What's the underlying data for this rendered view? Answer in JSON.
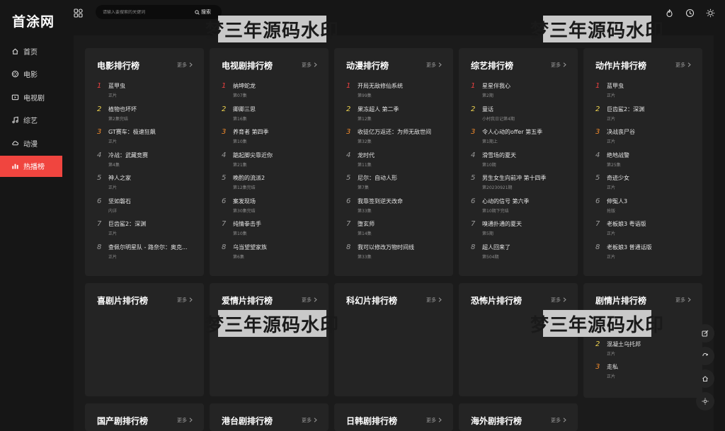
{
  "logo": "首涂网",
  "nav": [
    {
      "label": "首页",
      "icon": "home-icon"
    },
    {
      "label": "电影",
      "icon": "film-reel-icon"
    },
    {
      "label": "电视剧",
      "icon": "tv-icon"
    },
    {
      "label": "综艺",
      "icon": "music-note-icon"
    },
    {
      "label": "动漫",
      "icon": "cloud-icon"
    },
    {
      "label": "热播榜",
      "icon": "chart-icon",
      "active": true
    }
  ],
  "search": {
    "placeholder": "请输入要搜索的关键词",
    "button": "搜索"
  },
  "more_label": "更多",
  "watermark": "梦三年源码水印",
  "boards": [
    {
      "title": "电影排行榜",
      "items": [
        {
          "name": "蓝甲虫",
          "sub": "正片"
        },
        {
          "name": "植物也坏坏",
          "sub": "第2集完结"
        },
        {
          "name": "GT赛车：极速狂飙",
          "sub": "正片"
        },
        {
          "name": "冷战：武藏竞赛",
          "sub": "第4集"
        },
        {
          "name": "神人之家",
          "sub": "正片"
        },
        {
          "name": "坚如磐石",
          "sub": "内详"
        },
        {
          "name": "巨齿鲨2：深渊",
          "sub": "正片"
        },
        {
          "name": "查佩尔明星队 - 路奈尔：奥克...",
          "sub": "正片"
        }
      ]
    },
    {
      "title": "电视剧排行榜",
      "items": [
        {
          "name": "纳坤蛇龙",
          "sub": "第07集"
        },
        {
          "name": "卿卿三思",
          "sub": "第16集"
        },
        {
          "name": "养育者 第四季",
          "sub": "第10集"
        },
        {
          "name": "踮起脚尖靠近你",
          "sub": "第21集"
        },
        {
          "name": "晚酌的流派2",
          "sub": "第12集完结"
        },
        {
          "name": "案发现场",
          "sub": "第30集完结"
        },
        {
          "name": "纯情拳击手",
          "sub": "第10集"
        },
        {
          "name": "乌当望望家族",
          "sub": "第6集"
        }
      ]
    },
    {
      "title": "动漫排行榜",
      "items": [
        {
          "name": "开局无敌修仙系统",
          "sub": "第99集"
        },
        {
          "name": "果冻超人 第二季",
          "sub": "第12集"
        },
        {
          "name": "收徒亿万返还：为师无敌世间",
          "sub": "第32集"
        },
        {
          "name": "龙时代",
          "sub": "第11集"
        },
        {
          "name": "尼尔：自动人形",
          "sub": "第7集"
        },
        {
          "name": "我靠签到逆天改命",
          "sub": "第33集"
        },
        {
          "name": "堕玄师",
          "sub": "第14集"
        },
        {
          "name": "我可以修改万物时间线",
          "sub": "第33集"
        }
      ]
    },
    {
      "title": "综艺排行榜",
      "items": [
        {
          "name": "星星伴我心",
          "sub": "第2期"
        },
        {
          "name": "童话",
          "sub": "小村我日记第4期"
        },
        {
          "name": "令人心动的offer 第五季",
          "sub": "第1期上"
        },
        {
          "name": "滑雪场的夏天",
          "sub": "第10期"
        },
        {
          "name": "男生女生向前冲 第十四季",
          "sub": "第20230921期"
        },
        {
          "name": "心动的信号 第六季",
          "sub": "第10期下完结"
        },
        {
          "name": "嗅通扑通的夏天",
          "sub": "第5期"
        },
        {
          "name": "超人回来了",
          "sub": "第504期"
        }
      ]
    },
    {
      "title": "动作片排行榜",
      "items": [
        {
          "name": "蓝甲虫",
          "sub": "正片"
        },
        {
          "name": "巨齿鲨2：深渊",
          "sub": "正片"
        },
        {
          "name": "决战丧尸谷",
          "sub": "正片"
        },
        {
          "name": "绝地战警",
          "sub": "第25集"
        },
        {
          "name": "奇迹少女",
          "sub": "正片"
        },
        {
          "name": "伸冤人3",
          "sub": "抢版"
        },
        {
          "name": "老板娘3 粤语版",
          "sub": "正片"
        },
        {
          "name": "老板娘3 普通话版",
          "sub": "正片"
        }
      ]
    },
    {
      "title": "喜剧片排行榜",
      "items": []
    },
    {
      "title": "爱情片排行榜",
      "items": []
    },
    {
      "title": "科幻片排行榜",
      "items": []
    },
    {
      "title": "恐怖片排行榜",
      "items": []
    },
    {
      "title": "剧情片排行榜",
      "items": [
        {
          "name": "蓝甲虫",
          "sub": ""
        },
        {
          "name": "混凝土乌托邦",
          "sub": "正片"
        },
        {
          "name": "走私",
          "sub": "正片"
        }
      ]
    },
    {
      "title": "国产剧排行榜",
      "items": []
    },
    {
      "title": "港台剧排行榜",
      "items": []
    },
    {
      "title": "日韩剧排行榜",
      "items": []
    },
    {
      "title": "海外剧排行榜",
      "items": []
    }
  ],
  "colors": {
    "accent": "#f0453f",
    "rank1": "#ec4141",
    "rank2": "#eed34f",
    "rank3": "#f08a2c"
  }
}
